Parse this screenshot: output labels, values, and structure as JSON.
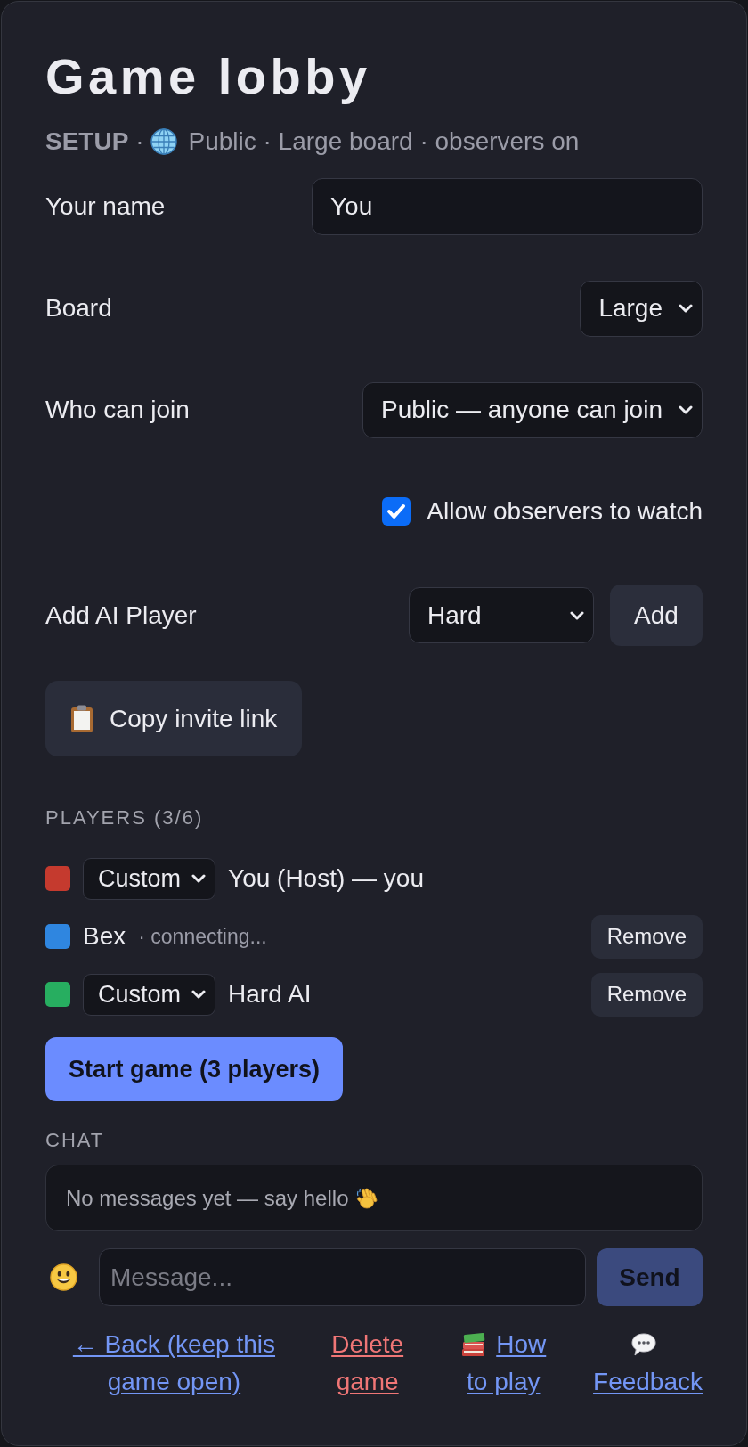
{
  "header": {
    "title": "Game lobby",
    "status": "**SETUP** ·",
    "summary": "Public · Large board · observers on"
  },
  "settings": [
    {
      "kind": "text",
      "label": "Your name",
      "value": "You"
    },
    {
      "kind": "select",
      "label": "Board",
      "value": "Large"
    },
    {
      "kind": "select",
      "label": "Who can join",
      "value": "Public — anyone can join"
    },
    {
      "kind": "checkbox",
      "label": "Allow observers to watch",
      "checked": true
    },
    {
      "kind": "select_button",
      "label": "Add AI Player",
      "value": "Hard",
      "button": "Add"
    }
  ],
  "invite_button": "Copy invite link",
  "players": {
    "heading": "PLAYERS (3/6)",
    "items": [
      {
        "color": "#c53a2e",
        "select": "Custom",
        "name": "You (Host) — you"
      },
      {
        "color": "#2f86e0",
        "name": "Bex",
        "note": "· connecting...",
        "action": "Remove"
      },
      {
        "color": "#27ae60",
        "select": "Custom",
        "name": "Hard AI",
        "action": "Remove"
      }
    ]
  },
  "start_button": "Start game (3 players)",
  "chat": {
    "heading": "CHAT",
    "empty_text": "No messages yet — say hello",
    "placeholder": "Message...",
    "send": {
      "label": "Send",
      "disabled": true
    }
  },
  "links": [
    {
      "kind": "back",
      "label": "← Back (keep this game open)"
    },
    {
      "kind": "danger",
      "label": "Delete game"
    },
    {
      "kind": "help",
      "label": "How to play"
    },
    {
      "kind": "feedback",
      "label": "Feedback"
    }
  ]
}
